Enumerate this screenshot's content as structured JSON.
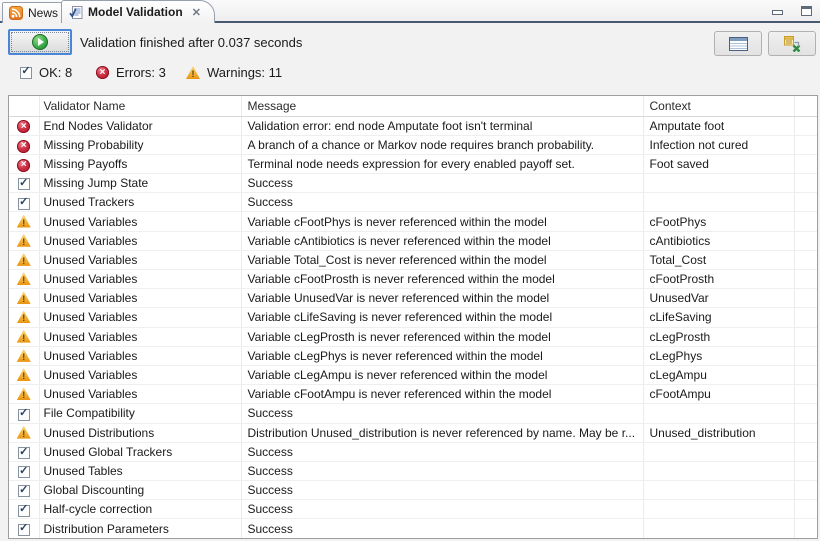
{
  "tabs": {
    "news": {
      "label": "News"
    },
    "model_validation": {
      "label": "Model Validation"
    }
  },
  "icons": {
    "error_glyph": "✕",
    "ok_glyph": "✓",
    "warning_glyph": "!",
    "close_glyph": "✕"
  },
  "toolbar": {
    "status_text": "Validation finished after 0.037 seconds"
  },
  "summary": {
    "ok": "OK: 8",
    "errors": "Errors: 3",
    "warnings": "Warnings: 11"
  },
  "table": {
    "columns": {
      "validator": "Validator Name",
      "message": "Message",
      "context": "Context"
    },
    "rows": [
      {
        "status": "error",
        "validator": "End Nodes Validator",
        "message": "Validation error: end node Amputate foot isn't terminal",
        "context": "Amputate foot"
      },
      {
        "status": "error",
        "validator": "Missing Probability",
        "message": "A branch of a chance or Markov node requires branch probability.",
        "context": "Infection not cured"
      },
      {
        "status": "error",
        "validator": "Missing Payoffs",
        "message": "Terminal node needs expression for every enabled payoff set.",
        "context": "Foot saved"
      },
      {
        "status": "ok",
        "validator": "Missing Jump State",
        "message": "Success",
        "context": ""
      },
      {
        "status": "ok",
        "validator": "Unused Trackers",
        "message": "Success",
        "context": ""
      },
      {
        "status": "warning",
        "validator": "Unused Variables",
        "message": "Variable cFootPhys is never referenced within the model",
        "context": "cFootPhys"
      },
      {
        "status": "warning",
        "validator": "Unused Variables",
        "message": "Variable cAntibiotics is never referenced within the model",
        "context": "cAntibiotics"
      },
      {
        "status": "warning",
        "validator": "Unused Variables",
        "message": "Variable Total_Cost is never referenced within the model",
        "context": "Total_Cost"
      },
      {
        "status": "warning",
        "validator": "Unused Variables",
        "message": "Variable cFootProsth is never referenced within the model",
        "context": "cFootProsth"
      },
      {
        "status": "warning",
        "validator": "Unused Variables",
        "message": "Variable UnusedVar is never referenced within the model",
        "context": "UnusedVar"
      },
      {
        "status": "warning",
        "validator": "Unused Variables",
        "message": "Variable cLifeSaving is never referenced within the model",
        "context": "cLifeSaving"
      },
      {
        "status": "warning",
        "validator": "Unused Variables",
        "message": "Variable cLegProsth is never referenced within the model",
        "context": "cLegProsth"
      },
      {
        "status": "warning",
        "validator": "Unused Variables",
        "message": "Variable cLegPhys is never referenced within the model",
        "context": "cLegPhys"
      },
      {
        "status": "warning",
        "validator": "Unused Variables",
        "message": "Variable cLegAmpu is never referenced within the model",
        "context": "cLegAmpu"
      },
      {
        "status": "warning",
        "validator": "Unused Variables",
        "message": "Variable cFootAmpu is never referenced within the model",
        "context": "cFootAmpu"
      },
      {
        "status": "ok",
        "validator": "File Compatibility",
        "message": "Success",
        "context": ""
      },
      {
        "status": "warning",
        "validator": "Unused Distributions",
        "message": "Distribution Unused_distribution is never referenced by name. May be r...",
        "context": "Unused_distribution"
      },
      {
        "status": "ok",
        "validator": "Unused Global Trackers",
        "message": "Success",
        "context": ""
      },
      {
        "status": "ok",
        "validator": "Unused Tables",
        "message": "Success",
        "context": ""
      },
      {
        "status": "ok",
        "validator": "Global Discounting",
        "message": "Success",
        "context": ""
      },
      {
        "status": "ok",
        "validator": "Half-cycle correction",
        "message": "Success",
        "context": ""
      },
      {
        "status": "ok",
        "validator": "Distribution Parameters",
        "message": "Success",
        "context": ""
      }
    ]
  },
  "colors": {
    "error_red": "#c22a3c",
    "warning_amber": "#e9940e",
    "ok_check_blue": "#27415f",
    "tab_underline": "#475a74",
    "play_green": "#3fae4e",
    "focus_border_blue": "#4a86d8"
  }
}
